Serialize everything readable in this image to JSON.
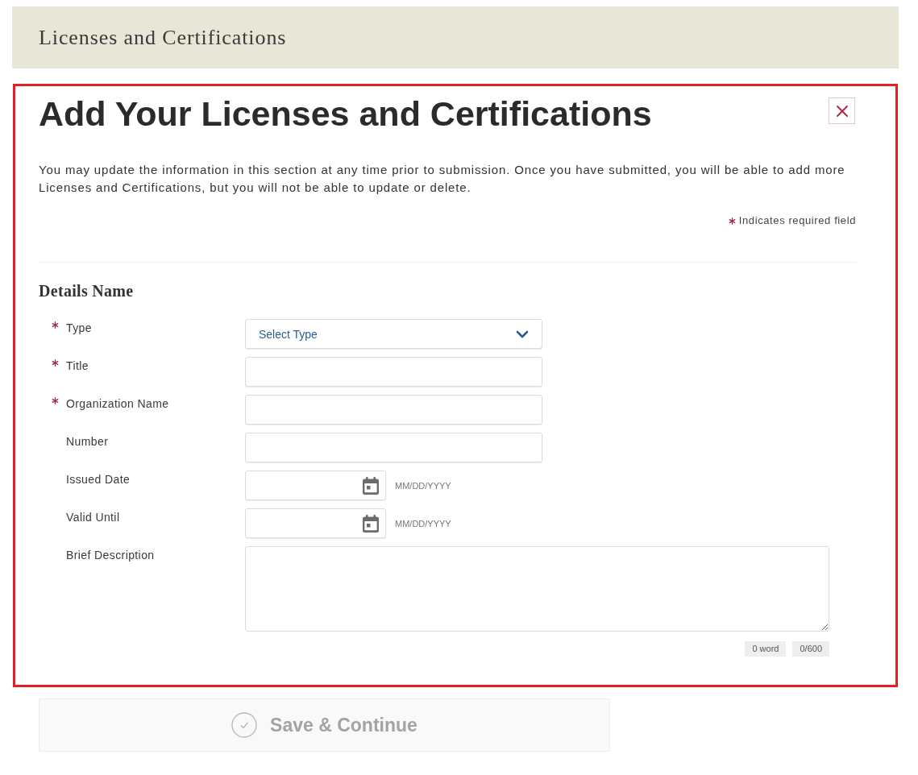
{
  "header": {
    "title": "Licenses and Certifications"
  },
  "dialog": {
    "highlighted": true,
    "title": "Add Your Licenses and Certifications",
    "intro": "You may update the information in this section at any time prior to submission. Once you have submitted, you will be able to add more Licenses and Certifications, but you will not be able to update or delete.",
    "required_note": "Indicates required field",
    "section_title": "Details Name",
    "fields": [
      {
        "kind": "select",
        "label": "Type",
        "required": true,
        "placeholder": "Select Type"
      },
      {
        "kind": "text",
        "label": "Title",
        "required": true
      },
      {
        "kind": "text",
        "label": "Organization Name",
        "required": true
      },
      {
        "kind": "text",
        "label": "Number",
        "required": false
      },
      {
        "kind": "date",
        "label": "Issued Date",
        "required": false,
        "hint": "MM/DD/YYYY"
      },
      {
        "kind": "date",
        "label": "Valid Until",
        "required": false,
        "hint": "MM/DD/YYYY"
      },
      {
        "kind": "textarea",
        "label": "Brief Description",
        "required": false,
        "word_count": "0 word",
        "char_count": "0/600"
      }
    ]
  },
  "save_button": {
    "label": "Save & Continue",
    "disabled": true
  }
}
